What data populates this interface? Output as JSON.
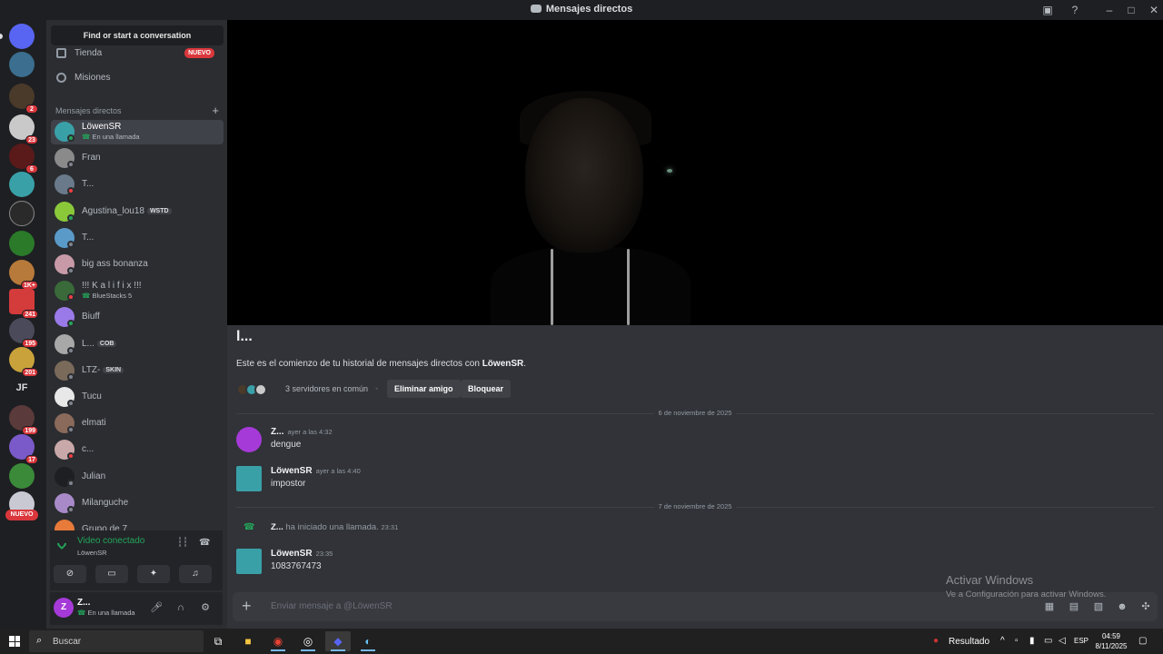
{
  "window": {
    "title": "Mensajes directos",
    "controls": [
      "minimize-icon",
      "maximize-icon",
      "close-icon"
    ]
  },
  "guilds": [
    {
      "name": "discord-home",
      "color": "#5865f2"
    },
    {
      "name": "guild-1",
      "color": "#3b6e8f"
    },
    {
      "name": "guild-2",
      "color": "#4a3a2a",
      "badge": "2"
    },
    {
      "name": "guild-3",
      "color": "#c9c9c9",
      "badge": "23"
    },
    {
      "name": "guild-4",
      "color": "#5a1a1a",
      "badge": "6"
    },
    {
      "name": "guild-5",
      "color": "#3aa0a8"
    },
    {
      "name": "guild-6",
      "color": "#2a2a2a"
    },
    {
      "name": "guild-7",
      "color": "#2a7a2a"
    },
    {
      "name": "guild-8",
      "color": "#b87a3a",
      "badge": "1K+"
    },
    {
      "name": "guild-9",
      "color": "#d43b3b",
      "badge": "241"
    },
    {
      "name": "guild-10",
      "color": "#4a4a5a",
      "badge": "195"
    },
    {
      "name": "guild-11",
      "color": "#c9a23b",
      "badge": "201"
    },
    {
      "name": "guild-12",
      "text": "JF"
    },
    {
      "name": "guild-13",
      "color": "#5a3a3a",
      "badge": "199"
    },
    {
      "name": "guild-14",
      "color": "#7a5ac8",
      "badge": "17"
    },
    {
      "name": "guild-15",
      "color": "#3a8a3a"
    },
    {
      "name": "guild-16",
      "color": "#c9c9d4"
    }
  ],
  "guild_nuevo": "NUEVO",
  "dm_sidebar": {
    "search_label": "Find or start a conversation",
    "nav": [
      {
        "label": "Tienda",
        "badge": "NUEVO"
      },
      {
        "label": "Misiones"
      }
    ],
    "header": "Mensajes directos",
    "items": [
      {
        "name": "LöwenSR",
        "sub": "En una llamada",
        "color": "#3aa0a8",
        "status": "on",
        "active": true
      },
      {
        "name": "Fran",
        "color": "#8a8a8a",
        "status": "off"
      },
      {
        "name": "T...",
        "color": "#6a7a8a",
        "status": "dnd"
      },
      {
        "name": "Agustina_lou18",
        "tag": "WSTD",
        "color": "#8ac83a",
        "status": "on"
      },
      {
        "name": "T...",
        "color": "#5a9ac8",
        "status": "off"
      },
      {
        "name": "big ass bonanza",
        "color": "#c89aa8",
        "status": "off"
      },
      {
        "name": "!!! K a l i f i x !!!",
        "sub": "BlueStacks 5",
        "color": "#3a6a3a",
        "status": "dnd"
      },
      {
        "name": "Biuff",
        "color": "#9a7ae8",
        "status": "on"
      },
      {
        "name": "L...",
        "tag": "COB",
        "color": "#a8a8a8",
        "status": "off"
      },
      {
        "name": "LTZ-",
        "tag": "SKIN",
        "color": "#7a6a5a",
        "status": "off"
      },
      {
        "name": "Tucu",
        "color": "#e8e8e8",
        "status": "off"
      },
      {
        "name": "elmati",
        "color": "#8a6a5a",
        "status": "off"
      },
      {
        "name": "c...",
        "color": "#c8a8a8",
        "status": "dnd"
      },
      {
        "name": "Julian",
        "color": "#1e1f22",
        "status": "off"
      },
      {
        "name": "Milanguche",
        "color": "#a88ac8",
        "status": "off"
      },
      {
        "name": "Grupo de 7",
        "color": "#e87a3a",
        "status": "off"
      }
    ]
  },
  "voice_panel": {
    "status": "Video conectado",
    "user": "LöwenSR",
    "buttons": [
      "camera-off-icon",
      "screen-share-icon",
      "activities-icon",
      "soundboard-icon"
    ]
  },
  "user_panel": {
    "avatar_letter": "Z",
    "name": "Z...",
    "status": "En una llamada"
  },
  "chat": {
    "title": "l...",
    "intro_prefix": "Este es el comienzo de tu historial de mensajes directos con ",
    "intro_user": "LöwenSR",
    "intro_suffix": ".",
    "servers_common": "3 servidores en común",
    "remove_friend": "Eliminar amigo",
    "block": "Bloquear",
    "date1": "6 de noviembre de 2025",
    "date2": "7 de noviembre de 2025",
    "messages": [
      {
        "author": "Z...",
        "time": "ayer a las 4:32",
        "body": "dengue"
      },
      {
        "author": "LöwenSR",
        "time": "ayer a las 4:40",
        "body": "impostor"
      },
      {
        "author": "LöwenSR",
        "time": "23:35",
        "body": "1083767473"
      }
    ],
    "call": {
      "author": "Z...",
      "text": " ha iniciado una llamada.",
      "time": "23:31"
    },
    "composer_placeholder": "Enviar mensaje a @LöwenSR"
  },
  "activate_windows": {
    "title": "Activar Windows",
    "subtitle": "Ve a Configuración para activar Windows."
  },
  "taskbar": {
    "search": "Buscar",
    "result": "Resultado",
    "lang": "ESP",
    "time": "04:59",
    "date": "8/11/2025"
  },
  "colors": {
    "accent": "#5865f2",
    "online": "#23a55a",
    "danger": "#da373c"
  }
}
